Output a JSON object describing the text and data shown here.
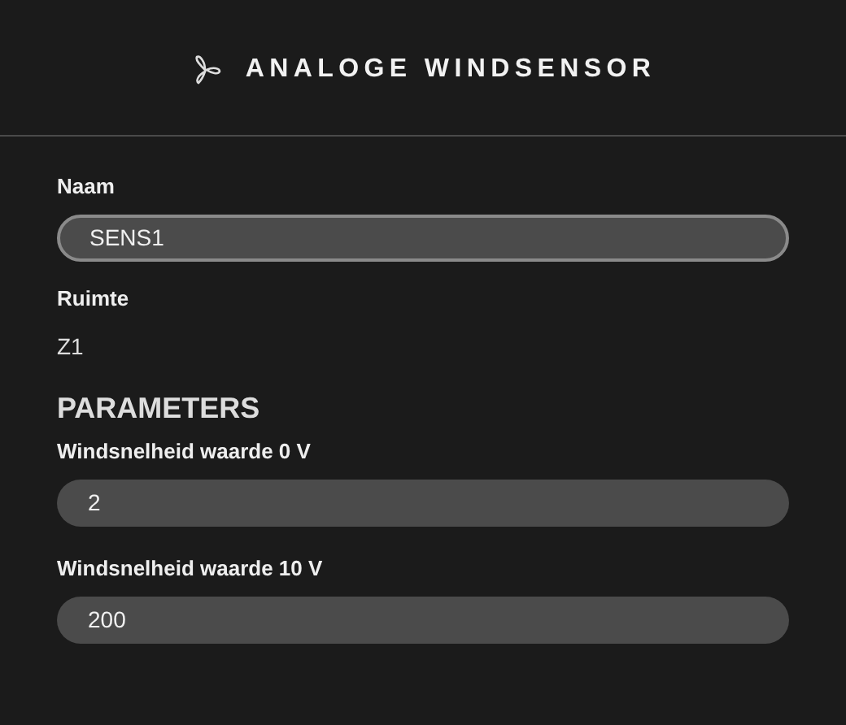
{
  "header": {
    "title": "ANALOGE WINDSENSOR"
  },
  "fields": [
    {
      "kind": "input",
      "label": "Naam",
      "value": "SENS1",
      "focused": true
    },
    {
      "kind": "text",
      "label": "Ruimte",
      "value": "Z1"
    }
  ],
  "parameters": {
    "heading": "PARAMETERS",
    "fields": [
      {
        "kind": "input",
        "label": "Windsnelheid waarde 0 V",
        "value": "2",
        "focused": false
      },
      {
        "kind": "input",
        "label": "Windsnelheid waarde 10 V",
        "value": "200",
        "focused": false
      }
    ]
  }
}
